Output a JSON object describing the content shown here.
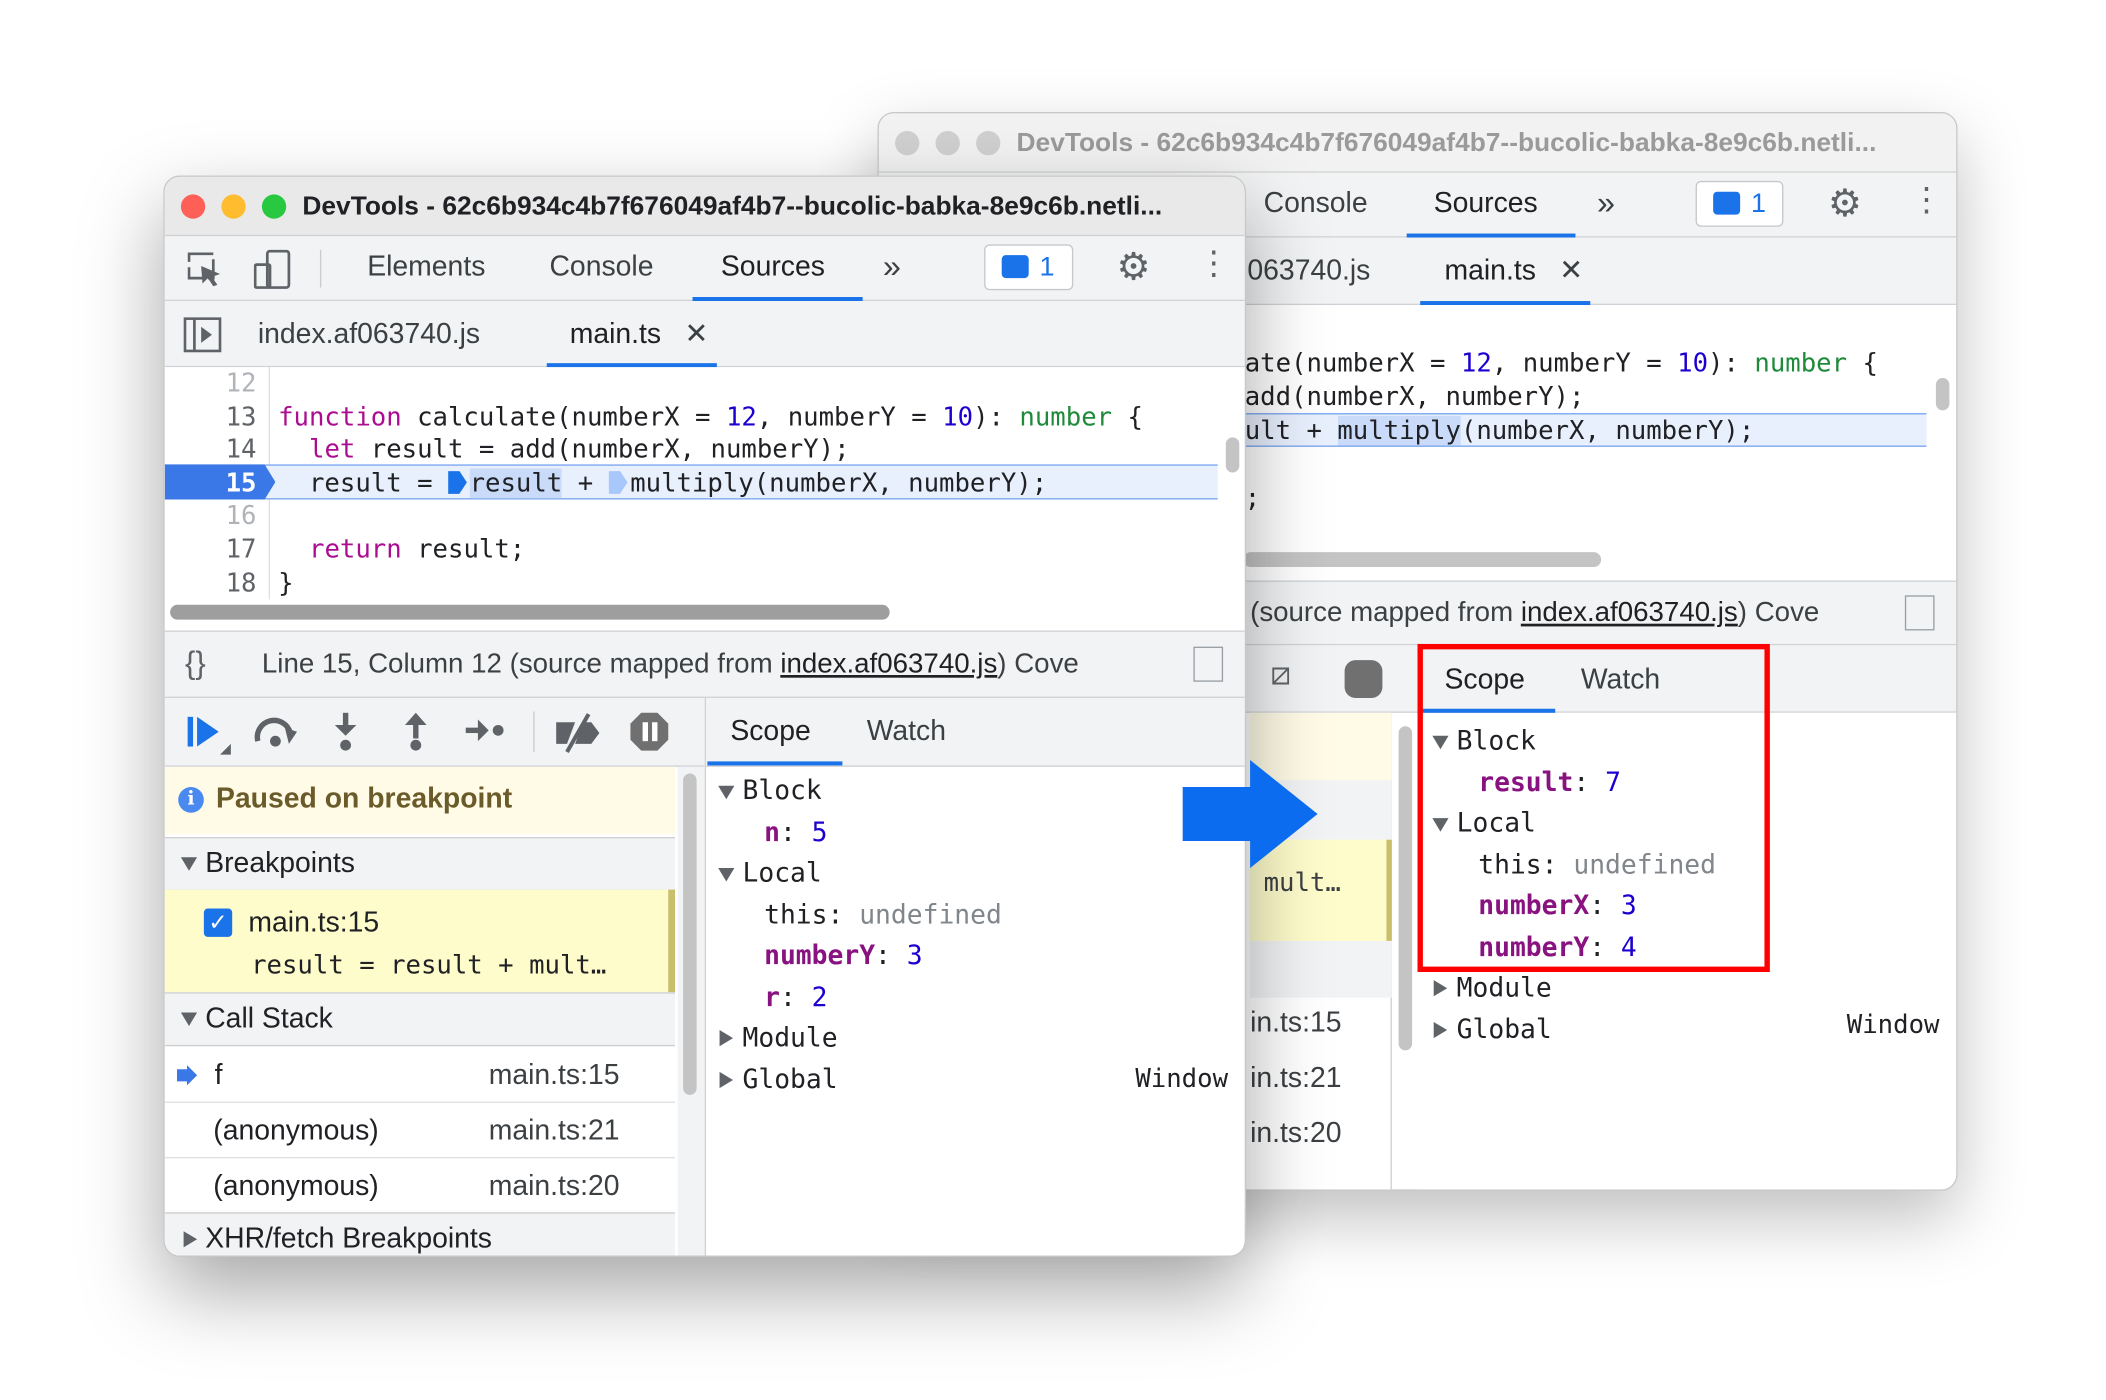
{
  "back_window": {
    "title": "DevTools - 62c6b934c4b7f676049af4b7--bucolic-babka-8e9c6b.netli...",
    "tabs": [
      "Console",
      "Sources"
    ],
    "more_tabs": "»",
    "issues_count": "1",
    "file_tabs": [
      "063740.js",
      "main.ts"
    ],
    "code_lines": [
      {
        "segments": [
          [
            "",
            "ate(numberX = "
          ],
          [
            "num",
            "12"
          ],
          [
            "",
            ", numberY = "
          ],
          [
            "num",
            "10"
          ],
          [
            "",
            "): "
          ],
          [
            "ty",
            "number"
          ],
          [
            "",
            " {"
          ]
        ]
      },
      {
        "segments": [
          [
            "",
            "add(numberX, numberY);"
          ]
        ]
      },
      {
        "segments": [
          [
            "",
            "ult + "
          ],
          [
            "sel",
            "multiply"
          ],
          [
            "",
            "(numberX, numberY);"
          ]
        ]
      },
      {
        "segments": [
          [
            "",
            ""
          ]
        ]
      },
      {
        "segments": [
          [
            "",
            ";"
          ]
        ]
      }
    ],
    "status_prefix": "(source mapped from ",
    "status_link": "index.af063740.js",
    "status_suffix": ") Cove",
    "sidebar_fragments": [
      "mult…",
      "in.ts:15",
      "in.ts:21",
      "in.ts:20"
    ],
    "scope_tabs": [
      "Scope",
      "Watch"
    ],
    "scope": {
      "block_label": "Block",
      "block_vars": [
        {
          "name": "result",
          "value": "7"
        }
      ],
      "local_label": "Local",
      "local_this_name": "this",
      "local_this_value": "undefined",
      "local_vars": [
        {
          "name": "numberX",
          "value": "3"
        },
        {
          "name": "numberY",
          "value": "4"
        }
      ],
      "module_label": "Module",
      "global_label": "Global",
      "global_value": "Window"
    },
    "highlight_color": "#ff0000"
  },
  "front_window": {
    "title": "DevTools - 62c6b934c4b7f676049af4b7--bucolic-babka-8e9c6b.netli...",
    "tabs": [
      "Elements",
      "Console",
      "Sources"
    ],
    "more_tabs": "»",
    "issues_count": "1",
    "file_tabs": [
      "index.af063740.js",
      "main.ts"
    ],
    "code_lines": [
      {
        "n": "12",
        "segments": [
          [
            "",
            ""
          ]
        ]
      },
      {
        "n": "13",
        "segments": [
          [
            "kw",
            "function"
          ],
          [
            "",
            " calculate(numberX = "
          ],
          [
            "num",
            "12"
          ],
          [
            "",
            ", numberY = "
          ],
          [
            "num",
            "10"
          ],
          [
            "",
            "): "
          ],
          [
            "ty",
            "number"
          ],
          [
            "",
            " {"
          ]
        ]
      },
      {
        "n": "14",
        "segments": [
          [
            "",
            "  "
          ],
          [
            "kw",
            "let"
          ],
          [
            "",
            " result = add(numberX, numberY);"
          ]
        ]
      },
      {
        "n": "15",
        "segments": [
          [
            "",
            "  result = "
          ],
          [
            "mark",
            ""
          ],
          [
            "sel",
            "result"
          ],
          [
            "",
            " + "
          ],
          [
            "mark2",
            ""
          ],
          [
            "",
            "multiply(numberX, numberY);"
          ]
        ]
      },
      {
        "n": "16",
        "segments": [
          [
            "",
            ""
          ]
        ]
      },
      {
        "n": "17",
        "segments": [
          [
            "",
            "  "
          ],
          [
            "kw",
            "return"
          ],
          [
            "",
            " result;"
          ]
        ]
      },
      {
        "n": "18",
        "segments": [
          [
            "",
            "}"
          ]
        ]
      }
    ],
    "current_line": "15",
    "status_prefix": "Line 15, Column 12  (source mapped from ",
    "status_link": "index.af063740.js",
    "status_suffix": ")  Cove",
    "paused_message": "Paused on breakpoint",
    "breakpoints_label": "Breakpoints",
    "breakpoint": {
      "location": "main.ts:15",
      "code": "result = result + mult…",
      "checked": true
    },
    "call_stack_label": "Call Stack",
    "call_stack": [
      {
        "name": "f",
        "location": "main.ts:15",
        "current": true
      },
      {
        "name": "(anonymous)",
        "location": "main.ts:21"
      },
      {
        "name": "(anonymous)",
        "location": "main.ts:20"
      }
    ],
    "xhr_label": "XHR/fetch Breakpoints",
    "scope_tabs": [
      "Scope",
      "Watch"
    ],
    "scope": {
      "block_label": "Block",
      "block_vars": [
        {
          "name": "n",
          "value": "5"
        }
      ],
      "local_label": "Local",
      "local_this_name": "this",
      "local_this_value": "undefined",
      "local_vars": [
        {
          "name": "numberY",
          "value": "3"
        },
        {
          "name": "r",
          "value": "2"
        }
      ],
      "module_label": "Module",
      "global_label": "Global",
      "global_value": "Window"
    }
  },
  "colors": {
    "accent": "#1a73e8",
    "arrow": "#0b6cf0",
    "paused_bg": "#fffbe6",
    "breakpoint_bg": "#fefccb"
  }
}
